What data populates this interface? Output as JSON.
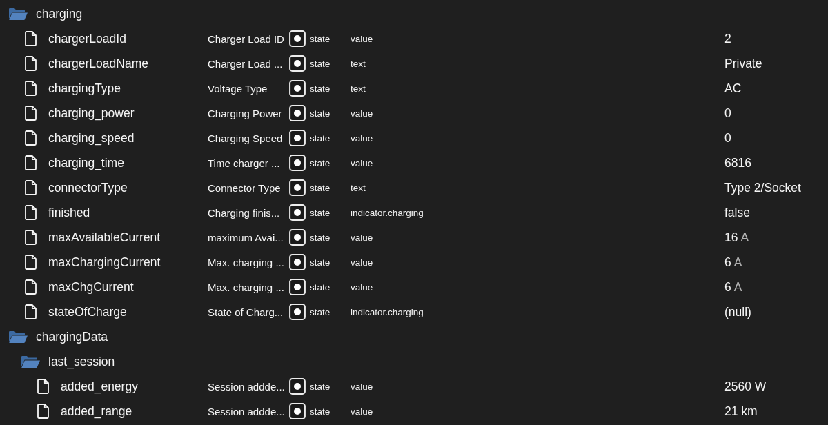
{
  "tree": [
    {
      "kind": "folder",
      "name": "charging",
      "expanded": true,
      "children": [
        {
          "kind": "state",
          "name": "chargerLoadId",
          "description": "Charger Load ID",
          "type": "state",
          "role": "value",
          "value": "2"
        },
        {
          "kind": "state",
          "name": "chargerLoadName",
          "description": "Charger Load ...",
          "type": "state",
          "role": "text",
          "value": "Private"
        },
        {
          "kind": "state",
          "name": "chargingType",
          "description": "Voltage Type",
          "type": "state",
          "role": "text",
          "value": "AC"
        },
        {
          "kind": "state",
          "name": "charging_power",
          "description": "Charging Power",
          "type": "state",
          "role": "value",
          "value": "0"
        },
        {
          "kind": "state",
          "name": "charging_speed",
          "description": "Charging Speed",
          "type": "state",
          "role": "value",
          "value": "0"
        },
        {
          "kind": "state",
          "name": "charging_time",
          "description": "Time charger ...",
          "type": "state",
          "role": "value",
          "value": "6816"
        },
        {
          "kind": "state",
          "name": "connectorType",
          "description": "Connector Type",
          "type": "state",
          "role": "text",
          "value": "Type 2/Socket"
        },
        {
          "kind": "state",
          "name": "finished",
          "description": "Charging finis...",
          "type": "state",
          "role": "indicator.charging",
          "value": "false"
        },
        {
          "kind": "state",
          "name": "maxAvailableCurrent",
          "description": "maximum Avai...",
          "type": "state",
          "role": "value",
          "value": "16",
          "unit": "A"
        },
        {
          "kind": "state",
          "name": "maxChargingCurrent",
          "description": "Max. charging ...",
          "type": "state",
          "role": "value",
          "value": "6",
          "unit": "A"
        },
        {
          "kind": "state",
          "name": "maxChgCurrent",
          "description": "Max. charging ...",
          "type": "state",
          "role": "value",
          "value": "6",
          "unit": "A"
        },
        {
          "kind": "state",
          "name": "stateOfCharge",
          "description": "State of Charg...",
          "type": "state",
          "role": "indicator.charging",
          "value": "(null)"
        }
      ]
    },
    {
      "kind": "folder",
      "name": "chargingData",
      "expanded": true,
      "children": [
        {
          "kind": "folder",
          "name": "last_session",
          "expanded": true,
          "children": [
            {
              "kind": "state",
              "name": "added_energy",
              "description": "Session addde...",
              "type": "state",
              "role": "value",
              "value": "2560 W"
            },
            {
              "kind": "state",
              "name": "added_range",
              "description": "Session addde...",
              "type": "state",
              "role": "value",
              "value": "21 km"
            }
          ]
        }
      ]
    }
  ]
}
